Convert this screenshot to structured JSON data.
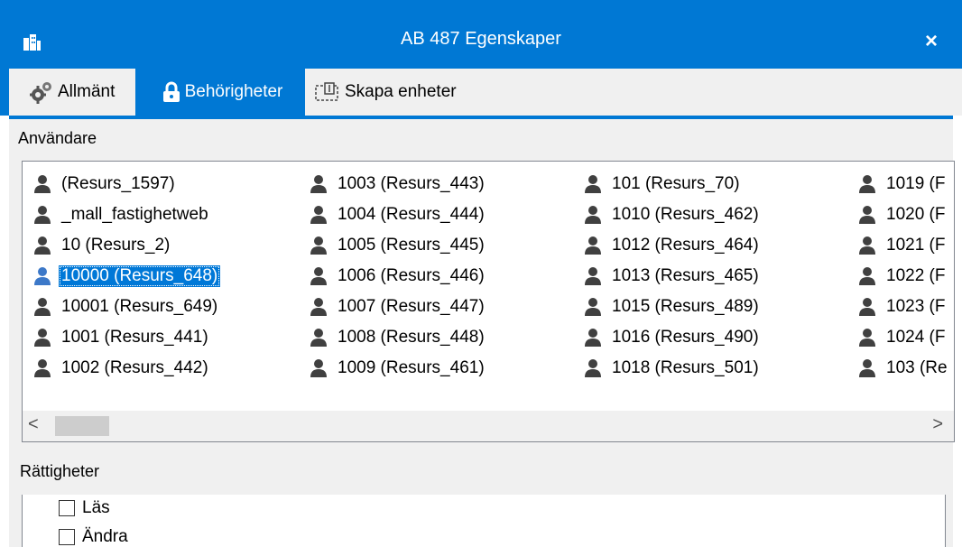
{
  "window": {
    "title": "AB 487 Egenskaper",
    "close_label": "×"
  },
  "tabs": [
    {
      "label": "Allmänt",
      "icon": "gears-icon"
    },
    {
      "label": "Behörigheter",
      "icon": "lock-icon"
    },
    {
      "label": "Skapa enheter",
      "icon": "create-units-icon"
    }
  ],
  "users": {
    "label": "Användare",
    "columns": [
      [
        {
          "text": "(Resurs_1597)"
        },
        {
          "text": "_mall_fastighetweb"
        },
        {
          "text": "10 (Resurs_2)"
        },
        {
          "text": "10000 (Resurs_648)",
          "selected": true
        },
        {
          "text": "10001 (Resurs_649)"
        },
        {
          "text": "1001 (Resurs_441)"
        },
        {
          "text": "1002 (Resurs_442)"
        }
      ],
      [
        {
          "text": "1003 (Resurs_443)"
        },
        {
          "text": "1004 (Resurs_444)"
        },
        {
          "text": "1005 (Resurs_445)"
        },
        {
          "text": "1006 (Resurs_446)"
        },
        {
          "text": "1007 (Resurs_447)"
        },
        {
          "text": "1008 (Resurs_448)"
        },
        {
          "text": "1009 (Resurs_461)"
        }
      ],
      [
        {
          "text": "101 (Resurs_70)"
        },
        {
          "text": "1010 (Resurs_462)"
        },
        {
          "text": "1012 (Resurs_464)"
        },
        {
          "text": "1013 (Resurs_465)"
        },
        {
          "text": "1015 (Resurs_489)"
        },
        {
          "text": "1016 (Resurs_490)"
        },
        {
          "text": "1018 (Resurs_501)"
        }
      ],
      [
        {
          "text": "1019 (F"
        },
        {
          "text": "1020 (F"
        },
        {
          "text": "1021 (F"
        },
        {
          "text": "1022 (F"
        },
        {
          "text": "1023 (F"
        },
        {
          "text": "1024 (F"
        },
        {
          "text": "103 (Re"
        }
      ]
    ],
    "scroll_left": "<",
    "scroll_right": ">"
  },
  "rights": {
    "label": "Rättigheter",
    "items": [
      {
        "label": "Läs",
        "checked": false
      },
      {
        "label": "Ändra",
        "checked": false
      }
    ]
  },
  "colors": {
    "accent": "#0078d4",
    "selected": "#0078d7",
    "panel": "#f0f0f0"
  }
}
